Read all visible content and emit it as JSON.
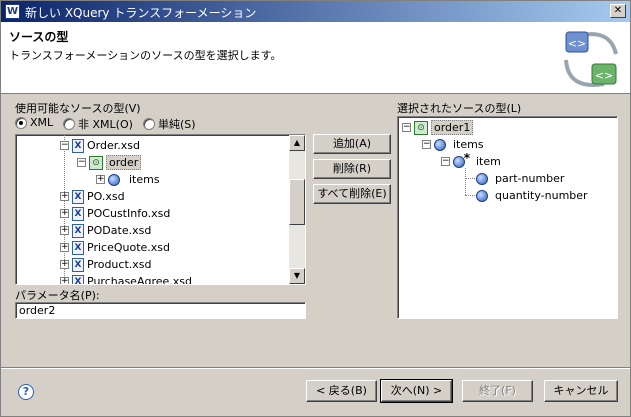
{
  "window": {
    "title": "新しい XQuery トランスフォーメーション",
    "app_icon": "W",
    "close_glyph": "✕"
  },
  "header": {
    "title": "ソースの型",
    "description": "トランスフォーメーションのソースの型を選択します。"
  },
  "left": {
    "label": "使用可能なソースの型(V)",
    "radios": [
      {
        "label": "XML",
        "selected": true
      },
      {
        "label": "非 XML(O)",
        "selected": false
      },
      {
        "label": "単純(S)",
        "selected": false
      }
    ],
    "tree": [
      {
        "label": "Order.xsd",
        "icon": "xsd-file-icon",
        "expander": "−"
      },
      {
        "label": "order",
        "icon": "xml-element-icon",
        "expander": "−"
      },
      {
        "label": "items",
        "icon": "element-icon",
        "expander": "+"
      },
      {
        "label": "PO.xsd",
        "icon": "xsd-file-icon",
        "expander": "+"
      },
      {
        "label": "POCustInfo.xsd",
        "icon": "xsd-file-icon",
        "expander": "+"
      },
      {
        "label": "PODate.xsd",
        "icon": "xsd-file-icon",
        "expander": "+"
      },
      {
        "label": "PriceQuote.xsd",
        "icon": "xsd-file-icon",
        "expander": "+"
      },
      {
        "label": "Product.xsd",
        "icon": "xsd-file-icon",
        "expander": "+"
      },
      {
        "label": "PurchaseAgree.xsd",
        "icon": "xsd-file-icon",
        "expander": "+"
      }
    ],
    "param_label": "パラメータ名(P):",
    "param_value": "order2"
  },
  "middle": {
    "add": "追加(A)",
    "remove": "削除(R)",
    "remove_all": "すべて削除(E)"
  },
  "right": {
    "label": "選択されたソースの型(L)",
    "tree": [
      {
        "label": "order1",
        "icon": "xml-element-icon",
        "expander": "−"
      },
      {
        "label": "items",
        "icon": "element-icon",
        "expander": "−"
      },
      {
        "label": "item",
        "icon": "element-star-icon",
        "expander": "−"
      },
      {
        "label": "part-number",
        "icon": "element-icon"
      },
      {
        "label": "quantity-number",
        "icon": "element-icon"
      }
    ]
  },
  "footer": {
    "help": "?",
    "back": "< 戻る(B)",
    "next": "次へ(N) >",
    "finish": "終了(F)",
    "cancel": "キャンセル"
  }
}
